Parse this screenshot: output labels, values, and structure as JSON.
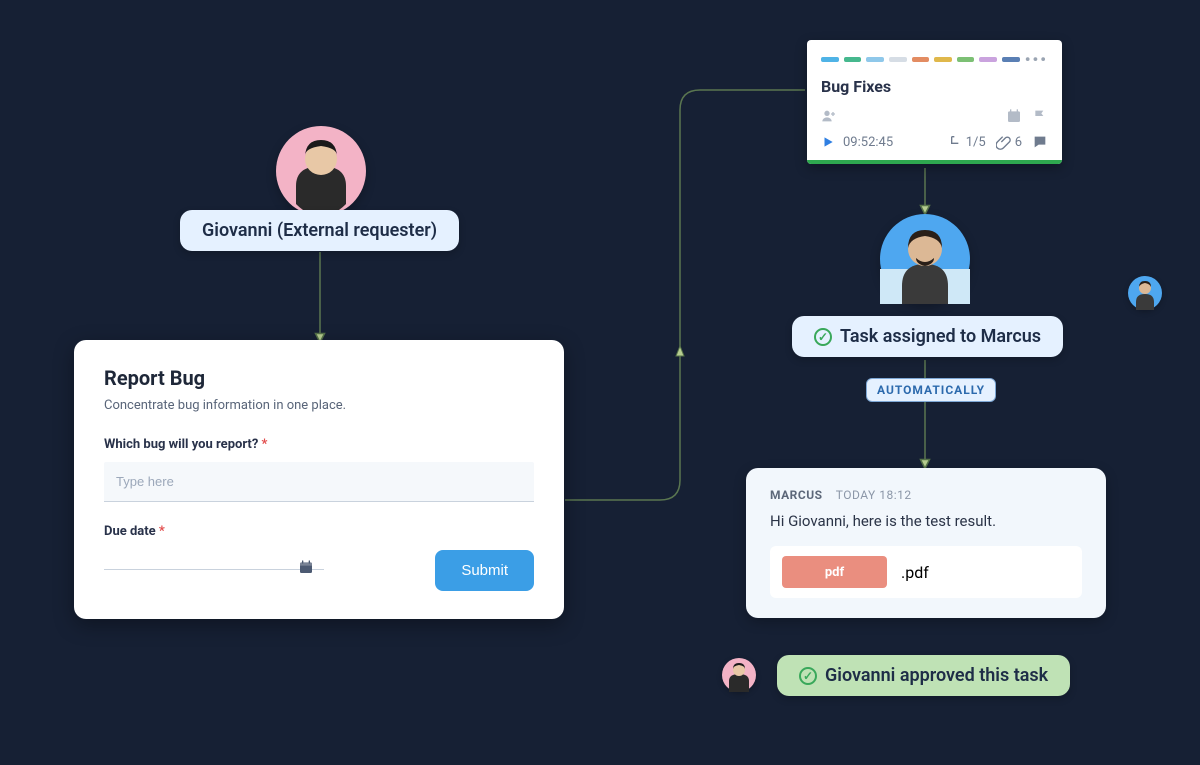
{
  "requester": {
    "name_label": "Giovanni (External requester)",
    "avatar_bg": "#f3b3c6"
  },
  "form": {
    "title": "Report Bug",
    "subtitle": "Concentrate bug information in one place.",
    "q1_label": "Which bug will you report?",
    "q1_placeholder": "Type here",
    "q2_label": "Due date",
    "submit_label": "Submit",
    "required_marker": "*"
  },
  "task_card": {
    "title": "Bug Fixes",
    "timer": "09:52:45",
    "subtasks": "1/5",
    "attachments": "6",
    "tags": [
      "#4fb3e6",
      "#46b88e",
      "#8fc8ea",
      "#d6dde5",
      "#e38c62",
      "#e0b84b",
      "#7cc074",
      "#caa3de",
      "#5a7fb4"
    ]
  },
  "assignee": {
    "name": "Marcus",
    "avatar_bg": "#4ea7f0",
    "assigned_label": "Task assigned to Marcus",
    "auto_badge": "AUTOMATICALLY"
  },
  "message": {
    "author": "MARCUS",
    "timestamp": "TODAY 18:12",
    "body": "Hi Giovanni, here is the test result.",
    "attachment_type": "pdf",
    "attachment_name": ".pdf"
  },
  "approval": {
    "label": "Giovanni approved this task"
  }
}
